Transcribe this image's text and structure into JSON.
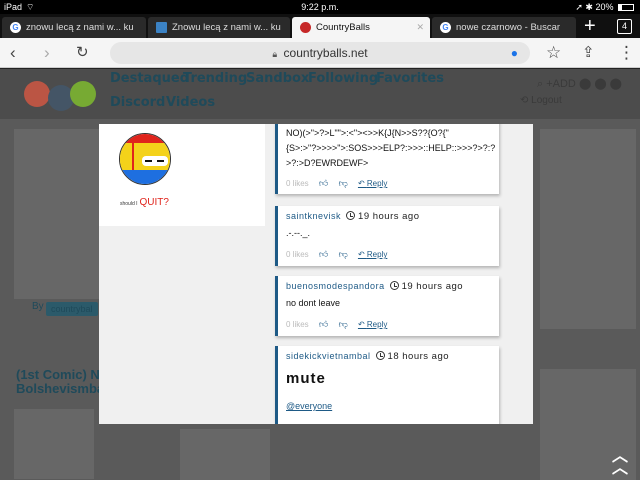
{
  "status_bar": {
    "device": "iPad",
    "time": "9:22 p.m.",
    "battery": "20%"
  },
  "tabs": [
    {
      "title": "znowu lecą z nami w... ku",
      "icon": "google-icon",
      "active": false
    },
    {
      "title": "Znowu lecą z nami w... ku",
      "icon": "page-icon",
      "active": false
    },
    {
      "title": "CountryBalls",
      "icon": "countryballs-icon",
      "active": true
    },
    {
      "title": "nowe czarnowo - Buscar",
      "icon": "google-icon",
      "active": false
    }
  ],
  "tab_count": "4",
  "url": "countryballs.net",
  "nav": {
    "links": [
      "Destaqued",
      "Trending",
      "Sandbox",
      "Following",
      "Favorites",
      "Discord",
      "Videos"
    ],
    "add_label": "ADD",
    "login_label": "Logout"
  },
  "background": {
    "by_label": "By",
    "post_title_1": "(1st Comic) N",
    "post_title_2": "Bolshevismba"
  },
  "modal": {
    "comic": {
      "small_text": "should I",
      "big_text": "QUIT?"
    },
    "comments": [
      {
        "author": "",
        "time": "",
        "text_lines": [
          "NO)(>\">?>L\"\">:<\"><>>K{J{N>>S??{O?{\"",
          "{S>:>\"?>>>>\">:SOS>>>ELP?:>>>::HELP::>>>?>?:?",
          ">?:>D?EWRDEWF>"
        ],
        "likes": "0 likes",
        "reply": "Reply"
      },
      {
        "author": "saintknevisk",
        "time": "19 hours ago",
        "text_lines": [
          ".-.--._."
        ],
        "likes": "0 likes",
        "reply": "Reply"
      },
      {
        "author": "buenosmodespandora",
        "time": "19 hours ago",
        "text_lines": [
          "no dont leave"
        ],
        "likes": "0 likes",
        "reply": "Reply"
      },
      {
        "author": "sidekickvietnambal",
        "time": "18 hours ago",
        "big_text": "mute",
        "mention": "@everyone"
      }
    ]
  }
}
